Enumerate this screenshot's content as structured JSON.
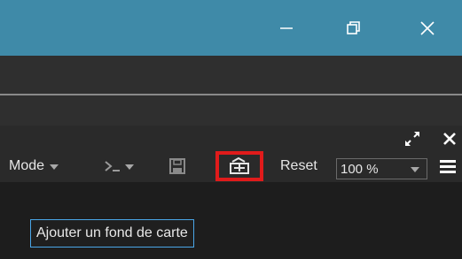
{
  "window": {
    "controls": {
      "minimize_icon": "minimize-icon",
      "maximize_icon": "restore-icon",
      "close_icon": "close-icon"
    },
    "titlebar_color": "#3f8aa8"
  },
  "panel": {
    "expand_icon": "expand-icon",
    "close_icon": "close-icon"
  },
  "toolbar": {
    "mode_label": "Mode",
    "console_icon": "console-icon",
    "save_icon": "save-icon",
    "basemap_icon": "add-basemap-icon",
    "reset_label": "Reset",
    "zoom_value": "100 %",
    "menu_icon": "hamburger-icon",
    "highlight_color": "#e01b1b"
  },
  "tooltip": {
    "text": "Ajouter un fond de carte"
  }
}
